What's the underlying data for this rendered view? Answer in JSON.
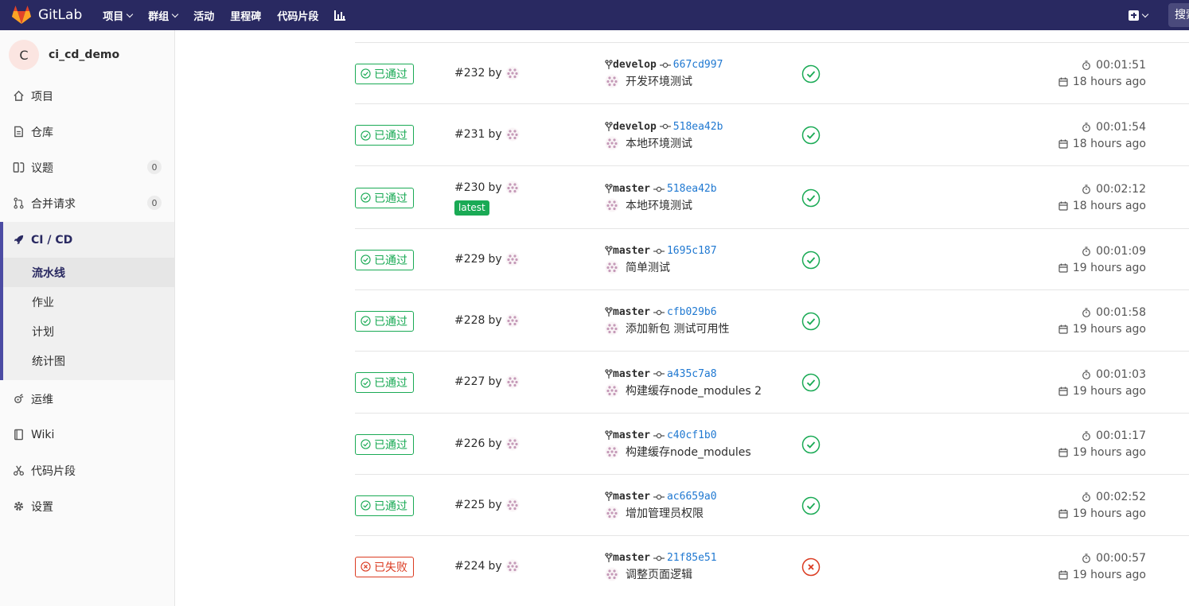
{
  "navbar": {
    "brand": "GitLab",
    "items": [
      {
        "label": "项目",
        "dropdown": true
      },
      {
        "label": "群组",
        "dropdown": true
      },
      {
        "label": "活动",
        "dropdown": false
      },
      {
        "label": "里程碑",
        "dropdown": false
      },
      {
        "label": "代码片段",
        "dropdown": false
      }
    ],
    "search_placeholder": "搜索"
  },
  "sidebar": {
    "project_avatar": "C",
    "project_name": "ci_cd_demo",
    "items": [
      {
        "label": "项目",
        "icon": "home-icon"
      },
      {
        "label": "仓库",
        "icon": "repository-icon"
      },
      {
        "label": "议题",
        "icon": "issues-icon",
        "badge": "0"
      },
      {
        "label": "合并请求",
        "icon": "merge-request-icon",
        "badge": "0"
      }
    ],
    "cicd": {
      "label": "CI / CD",
      "icon": "rocket-icon",
      "sub_items": [
        "流水线",
        "作业",
        "计划",
        "统计图"
      ],
      "active": "流水线"
    },
    "items_after": [
      {
        "label": "运维",
        "icon": "operations-icon"
      },
      {
        "label": "Wiki",
        "icon": "book-icon"
      },
      {
        "label": "代码片段",
        "icon": "snippet-icon"
      },
      {
        "label": "设置",
        "icon": "settings-icon"
      }
    ]
  },
  "colors": {
    "navbar": "#292961",
    "success": "#1aaa55",
    "failed": "#db3b21",
    "link": "#1f78d1"
  },
  "pipelines": [
    {
      "status": "已通过",
      "state": "success",
      "id": "#232",
      "by": "by",
      "branch": "develop",
      "sha": "667cd997",
      "message": "开发环境测试",
      "duration": "00:01:51",
      "finished": "18 hours ago"
    },
    {
      "status": "已通过",
      "state": "success",
      "id": "#231",
      "by": "by",
      "branch": "develop",
      "sha": "518ea42b",
      "message": "本地环境测试",
      "duration": "00:01:54",
      "finished": "18 hours ago"
    },
    {
      "status": "已通过",
      "state": "success",
      "id": "#230",
      "by": "by",
      "latest": "latest",
      "branch": "master",
      "sha": "518ea42b",
      "message": "本地环境测试",
      "duration": "00:02:12",
      "finished": "18 hours ago"
    },
    {
      "status": "已通过",
      "state": "success",
      "id": "#229",
      "by": "by",
      "branch": "master",
      "sha": "1695c187",
      "message": "简单测试",
      "duration": "00:01:09",
      "finished": "19 hours ago"
    },
    {
      "status": "已通过",
      "state": "success",
      "id": "#228",
      "by": "by",
      "branch": "master",
      "sha": "cfb029b6",
      "message": "添加新包 测试可用性",
      "duration": "00:01:58",
      "finished": "19 hours ago"
    },
    {
      "status": "已通过",
      "state": "success",
      "id": "#227",
      "by": "by",
      "branch": "master",
      "sha": "a435c7a8",
      "message": "构建缓存node_modules 2",
      "duration": "00:01:03",
      "finished": "19 hours ago"
    },
    {
      "status": "已通过",
      "state": "success",
      "id": "#226",
      "by": "by",
      "branch": "master",
      "sha": "c40cf1b0",
      "message": "构建缓存node_modules",
      "duration": "00:01:17",
      "finished": "19 hours ago"
    },
    {
      "status": "已通过",
      "state": "success",
      "id": "#225",
      "by": "by",
      "branch": "master",
      "sha": "ac6659a0",
      "message": "增加管理员权限",
      "duration": "00:02:52",
      "finished": "19 hours ago"
    },
    {
      "status": "已失败",
      "state": "failed",
      "id": "#224",
      "by": "by",
      "branch": "master",
      "sha": "21f85e51",
      "message": "调整页面逻辑",
      "duration": "00:00:57",
      "finished": "19 hours ago"
    }
  ]
}
